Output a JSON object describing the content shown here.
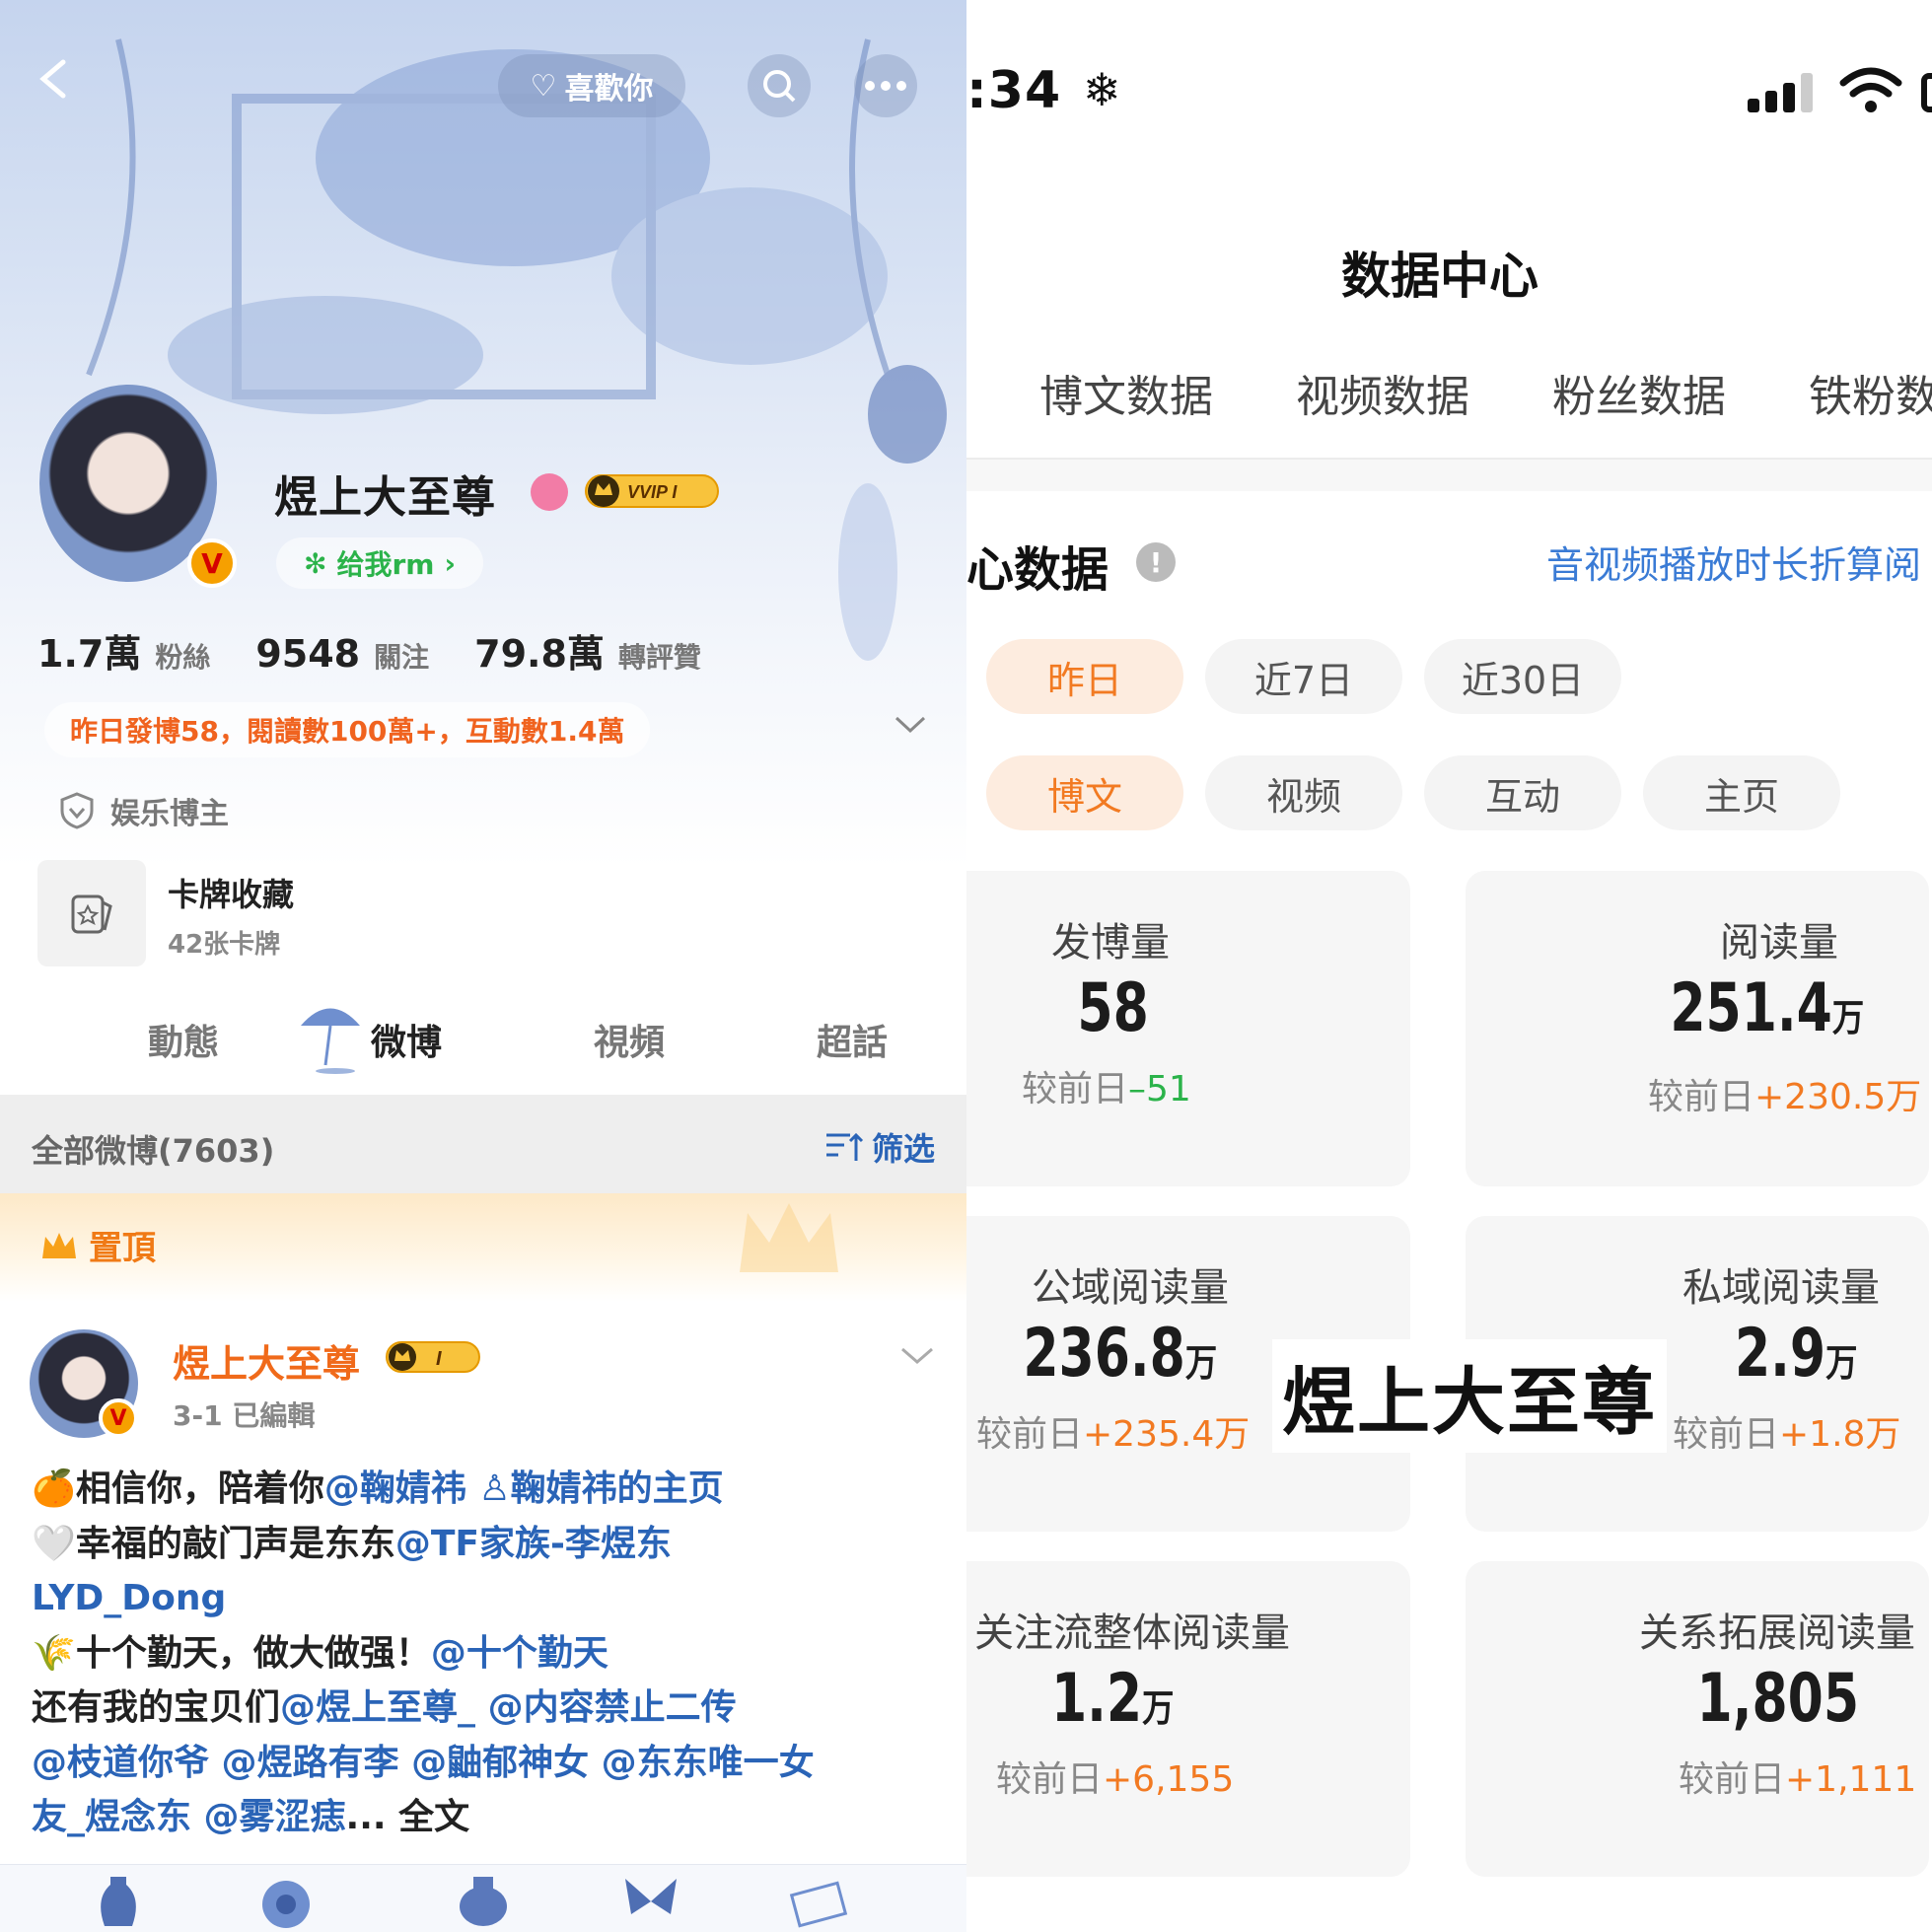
{
  "left": {
    "top": {
      "like_label": "喜歡你"
    },
    "profile": {
      "username": "煜上大至尊",
      "vip_label": "VVIP I",
      "v_mark": "V",
      "give_label": "给我rm",
      "stats": [
        {
          "num": "1.7萬",
          "label": "粉絲"
        },
        {
          "num": "9548",
          "label": "關注"
        },
        {
          "num": "79.8萬",
          "label": "轉評贊"
        }
      ],
      "activity": "昨日發博58，閱讀數100萬+，互動數1.4萬",
      "role": "娱乐博主",
      "cards": {
        "title": "卡牌收藏",
        "sub": "42张卡牌"
      }
    },
    "tabs": [
      "動態",
      "微博",
      "視頻",
      "超話"
    ],
    "filter": {
      "count_label": "全部微博(7603)",
      "filter_label": "筛选"
    },
    "pinned_label": "置頂",
    "post": {
      "author": "煜上大至尊",
      "badge": "I",
      "meta": "3-1  已編輯",
      "lines": [
        {
          "emoji": "🍊",
          "parts": [
            {
              "t": "相信你，陪着你",
              "m": false
            },
            {
              "t": "@鞠婧祎",
              "m": true
            },
            {
              "t": "  ",
              "m": false
            },
            {
              "t": "♙鞠婧祎的主页",
              "m": true
            }
          ]
        },
        {
          "emoji": "🤍",
          "parts": [
            {
              "t": "幸福的敲门声是东东",
              "m": false
            },
            {
              "t": "@TF家族-李煜东",
              "m": true
            }
          ]
        },
        {
          "emoji": "",
          "parts": [
            {
              "t": "LYD_Dong",
              "m": true
            }
          ]
        },
        {
          "emoji": "🌾",
          "parts": [
            {
              "t": "十个勤天，做大做强！",
              "m": false
            },
            {
              "t": "@十个勤天",
              "m": true
            }
          ]
        },
        {
          "emoji": "",
          "parts": [
            {
              "t": "还有我的宝贝们",
              "m": false
            },
            {
              "t": "@煜上至尊_",
              "m": true
            },
            {
              "t": " ",
              "m": false
            },
            {
              "t": "@内容禁止二传",
              "m": true
            }
          ]
        },
        {
          "emoji": "",
          "parts": [
            {
              "t": "@枝道你爷 @煜路有李  @鼬郁神女  @东东唯一女",
              "m": true
            }
          ]
        },
        {
          "emoji": "",
          "parts": [
            {
              "t": "友_煜念东 @雾涩痣",
              "m": true
            },
            {
              "t": "... 全文",
              "m": false
            }
          ]
        }
      ]
    }
  },
  "right": {
    "status": {
      "time": ":34"
    },
    "title": "数据中心",
    "tabs": [
      "博文数据",
      "视频数据",
      "粉丝数据",
      "铁粉数"
    ],
    "section": {
      "title": "心数据",
      "link": "音视频播放时长折算阅"
    },
    "period_chips": [
      "昨日",
      "近7日",
      "近30日"
    ],
    "type_chips": [
      "博文",
      "视频",
      "互动",
      "主页"
    ],
    "compare_prefix": "较前日",
    "metrics": [
      {
        "label": "发博量",
        "value": "58",
        "unit": "",
        "delta": "–51",
        "dir": "down"
      },
      {
        "label": "阅读量",
        "value": "251.4",
        "unit": "万",
        "delta": "+230.5万",
        "dir": "up"
      },
      {
        "label": "公域阅读量",
        "value": "236.8",
        "unit": "万",
        "delta": "+235.4万",
        "dir": "up"
      },
      {
        "label": "私域阅读量",
        "value": "2.9",
        "unit": "万",
        "delta": "+1.8万",
        "dir": "up"
      },
      {
        "label": "关注流整体阅读量",
        "value": "1.2",
        "unit": "万",
        "delta": "+6,155",
        "dir": "up"
      },
      {
        "label": "关系拓展阅读量",
        "value": "1,805",
        "unit": "",
        "delta": "+1,111",
        "dir": "up"
      }
    ]
  },
  "overlay_name": "煜上大至尊",
  "colors": {
    "orange": "#f27a22",
    "green": "#2bb34a",
    "link_blue": "#2a64b7",
    "chip_bg": "#fdecdf"
  }
}
